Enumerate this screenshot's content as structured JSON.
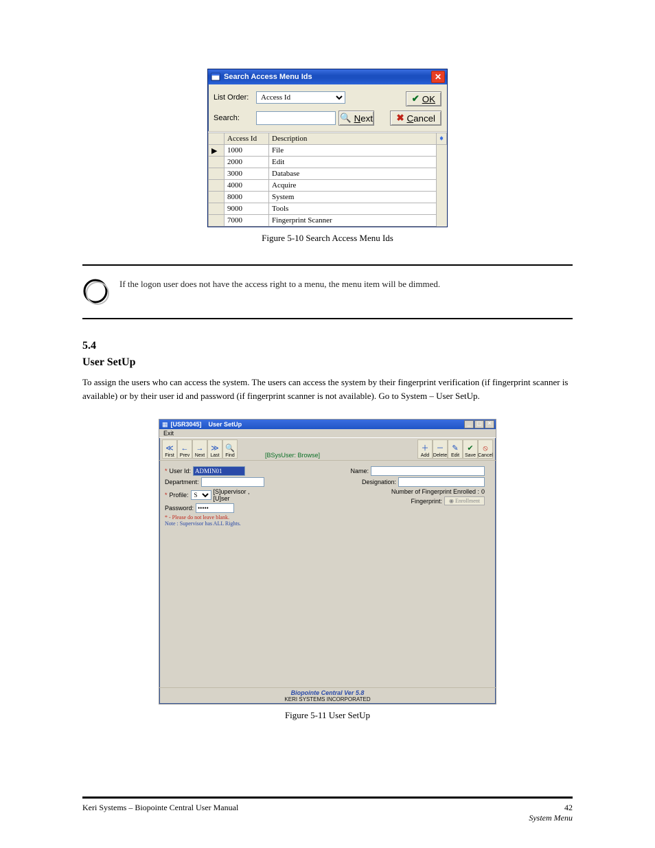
{
  "page": {
    "caption_search": "Figure 5-10 Search Access Menu Ids",
    "section_number": "5.4",
    "section_title": "User SetUp",
    "section_text": "To assign the users who can access the system. The users can access the system by their fingerprint verification (if fingerprint scanner is available) or by their user id and password (if fingerprint scanner is not available). Go to System – User SetUp.",
    "caption_user": "Figure 5-11 User SetUp",
    "footer_title": "Keri Systems – Biopointe Central User Manual",
    "footer_right": "System Menu",
    "footer_page": "42"
  },
  "callout": {
    "text_lead": "If the logon user does not have the access right to a menu, the menu ",
    "text_tail": "item will be dimmed."
  },
  "search_win": {
    "title": "Search Access Menu Ids",
    "list_order_label": "List Order:",
    "list_order_value": "Access Id",
    "search_label": "Search:",
    "next_btn": "Next",
    "ok_btn": "OK",
    "cancel_btn": "Cancel",
    "col_access": "Access Id",
    "col_desc": "Description",
    "rows": [
      {
        "id": "1000",
        "desc": "File"
      },
      {
        "id": "2000",
        "desc": "Edit"
      },
      {
        "id": "3000",
        "desc": "Database"
      },
      {
        "id": "4000",
        "desc": "Acquire"
      },
      {
        "id": "8000",
        "desc": "System"
      },
      {
        "id": "9000",
        "desc": "Tools"
      },
      {
        "id": "7000",
        "desc": "Fingerprint Scanner"
      }
    ]
  },
  "user_win": {
    "title_code": "[USR3045]",
    "title": "User SetUp",
    "menu_exit": "Exit",
    "nav": {
      "first": "First",
      "prev": "Prev",
      "next": "Next",
      "last": "Last",
      "find": "Find"
    },
    "mode": "[BSysUser: Browse]",
    "actions": {
      "add": "Add",
      "delete": "Delete",
      "edit": "Edit",
      "save": "Save",
      "cancel": "Cancel"
    },
    "fields": {
      "user_id_label": "User Id:",
      "user_id_value": "ADMIN01",
      "dept_label": "Department:",
      "profile_label": "Profile:",
      "profile_value": "S",
      "profile_hint": "[S]upervisor , [U]ser",
      "password_label": "Password:",
      "password_value": "*****",
      "name_label": "Name:",
      "designation_label": "Designation:",
      "fp_enrolled_label": "Number of Fingerprint Enrolled :",
      "fp_enrolled_value": "0",
      "fingerprint_label": "Fingerprint:",
      "fingerprint_btn": "Enrollment"
    },
    "hints": {
      "line1": "* - Please do not leave blank.",
      "line2": "Note : Supervisor has ALL Rights."
    },
    "status": {
      "product": "Biopointe Central Ver 5.8",
      "company": "KERI SYSTEMS INCORPORATED"
    }
  }
}
